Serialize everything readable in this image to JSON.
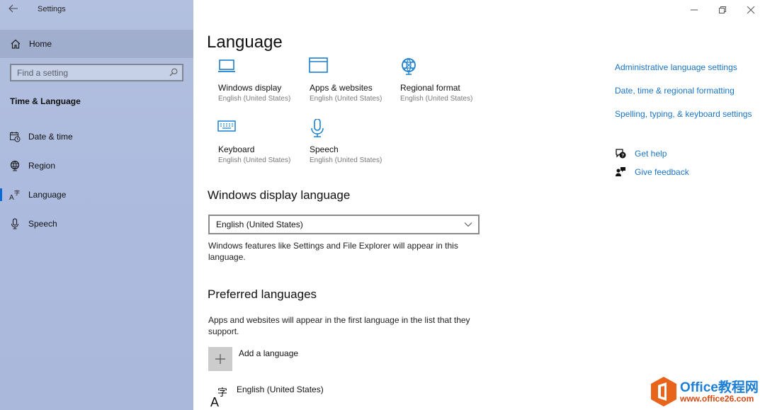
{
  "window": {
    "title": "Settings",
    "controls": [
      "minimize",
      "restore",
      "close"
    ]
  },
  "sidebar": {
    "home_label": "Home",
    "search_placeholder": "Find a setting",
    "section_title": "Time & Language",
    "items": [
      {
        "label": "Date & time",
        "icon": "calendar-clock-icon",
        "selected": false
      },
      {
        "label": "Region",
        "icon": "globe-icon",
        "selected": false
      },
      {
        "label": "Language",
        "icon": "language-icon",
        "selected": true
      },
      {
        "label": "Speech",
        "icon": "microphone-icon",
        "selected": false
      }
    ]
  },
  "main": {
    "page_title": "Language",
    "tiles": [
      {
        "name": "Windows display",
        "value": "English (United States)",
        "icon": "laptop-icon"
      },
      {
        "name": "Apps & websites",
        "value": "English (United States)",
        "icon": "window-icon"
      },
      {
        "name": "Regional format",
        "value": "English (United States)",
        "icon": "globe-icon"
      },
      {
        "name": "Keyboard",
        "value": "English (United States)",
        "icon": "keyboard-icon"
      },
      {
        "name": "Speech",
        "value": "English (United States)",
        "icon": "microphone-icon"
      }
    ],
    "display_language": {
      "heading": "Windows display language",
      "selected": "English (United States)",
      "description": "Windows features like Settings and File Explorer will appear in this language."
    },
    "preferred_languages": {
      "heading": "Preferred languages",
      "description": "Apps and websites will appear in the first language in the list that they support.",
      "add_label": "Add a language",
      "languages": [
        "English (United States)"
      ]
    }
  },
  "related": {
    "links": [
      "Administrative language settings",
      "Date, time & regional formatting",
      "Spelling, typing, & keyboard settings"
    ],
    "help": "Get help",
    "feedback": "Give feedback"
  },
  "watermark": {
    "title": "Office教程网",
    "url": "www.office26.com"
  },
  "colors": {
    "accent": "#0a6ad6",
    "icon_blue": "#1a7fd0",
    "link": "#1a74c4",
    "sidebar_bg": "#adbbde"
  }
}
